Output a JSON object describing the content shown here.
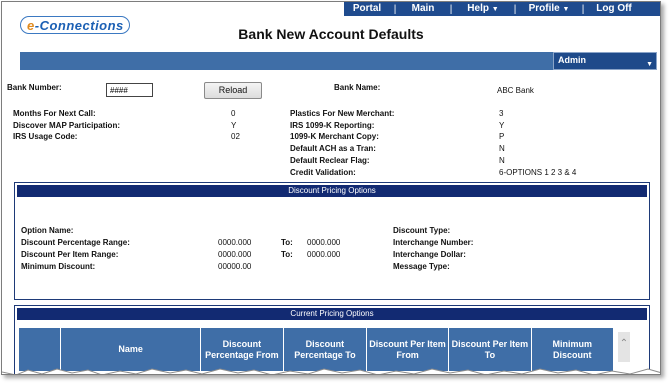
{
  "nav": {
    "items": [
      {
        "label": "Portal"
      },
      {
        "label": "Main"
      },
      {
        "label": "Help",
        "icon": "dropdown-arrow"
      },
      {
        "label": "Profile",
        "icon": "dropdown-arrow"
      },
      {
        "label": "Log Off"
      }
    ],
    "separator": "|"
  },
  "logo": {
    "text_e": "e",
    "text_rest": "-Connections"
  },
  "page": {
    "title": "Bank New Account Defaults"
  },
  "role_select": {
    "value": "Admin"
  },
  "form": {
    "bank_number_label": "Bank Number:",
    "bank_number_value": "####",
    "reload_label": "Reload",
    "bank_name_label": "Bank Name:",
    "bank_name_value": "ABC Bank"
  },
  "settings_left": [
    {
      "label": "Months For Next Call:",
      "value": "0"
    },
    {
      "label": "Discover MAP Participation:",
      "value": "Y"
    },
    {
      "label": "IRS Usage Code:",
      "value": "02"
    }
  ],
  "settings_right": [
    {
      "label": "Plastics For New Merchant:",
      "value": "3"
    },
    {
      "label": "IRS 1099-K Reporting:",
      "value": "Y"
    },
    {
      "label": "1099-K Merchant Copy:",
      "value": "P"
    },
    {
      "label": "Default ACH as a Tran:",
      "value": "N"
    },
    {
      "label": "Default Reclear Flag:",
      "value": "N"
    },
    {
      "label": "Credit Validation:",
      "value": "6-OPTIONS 1 2 3 & 4"
    }
  ],
  "discount_panel": {
    "title": "Discount Pricing Options",
    "option_name_label": "Option Name:",
    "pct_range_label": "Discount Percentage Range:",
    "pct_from": "0000.000",
    "pct_to": "0000.000",
    "per_item_label": "Discount Per Item Range:",
    "item_from": "0000.000",
    "item_to": "0000.000",
    "to_label": "To:",
    "min_discount_label": "Minimum Discount:",
    "min_discount_value": "00000.00",
    "discount_type_label": "Discount Type:",
    "interchange_number_label": "Interchange Number:",
    "interchange_dollar_label": "Interchange Dollar:",
    "message_type_label": "Message Type:"
  },
  "current_panel": {
    "title": "Current Pricing Options",
    "columns": [
      "",
      "Name",
      "Discount Percentage From",
      "Discount Percentage To",
      "Discount Per Item From",
      "Discount Per Item To",
      "Minimum Discount"
    ]
  },
  "colors": {
    "nav_bg": "#1f4b8e",
    "header_bar": "#3f6ea7",
    "panel_head": "#122a72"
  }
}
